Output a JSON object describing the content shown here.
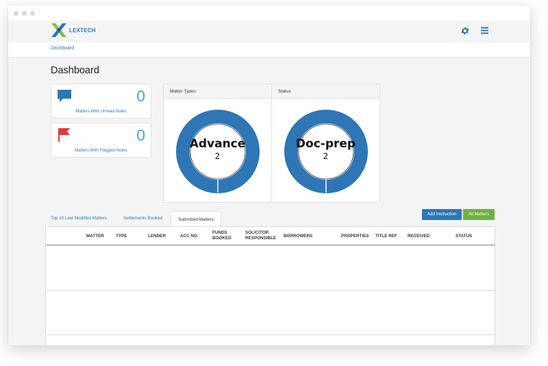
{
  "app": {
    "logo_text": "LEXTECH"
  },
  "breadcrumb": "Dashboard",
  "page_title": "Dashboard",
  "cards": [
    {
      "count": "0",
      "label": "Matters With Unread Notes",
      "icon": "chat-icon",
      "color": "#2e76b6"
    },
    {
      "count": "0",
      "label": "Matters With Flagged Notes",
      "icon": "flag-icon",
      "color": "#e23b3b"
    }
  ],
  "charts": [
    {
      "header": "Matter Types",
      "center_label": "Advance",
      "center_value": "2"
    },
    {
      "header": "Status",
      "center_label": "Doc-prep",
      "center_value": "2"
    }
  ],
  "tabs": [
    "Top 10 Last Modified Matters",
    "Settlements Booked",
    "Submitted Matters"
  ],
  "active_tab": "Submitted Matters",
  "buttons": {
    "add_instruction": "Add Instruction",
    "all_matters": "All Matters"
  },
  "table": {
    "headers": [
      "MATTER",
      "TYPE",
      "LENDER",
      "ACC NO.",
      "FUNDS BOOKED",
      "SOLICITOR RESPONSIBLE",
      "BORROWERS",
      "PROPERTIES",
      "TITLE REF",
      "RECEIVED",
      "STATUS"
    ]
  },
  "colors": {
    "accent": "#2e76b6",
    "donut": "#2e76b6",
    "count": "#47a5d8",
    "add_btn": "#2e76b6",
    "all_btn": "#6db33f",
    "flag": "#e23b3b"
  }
}
